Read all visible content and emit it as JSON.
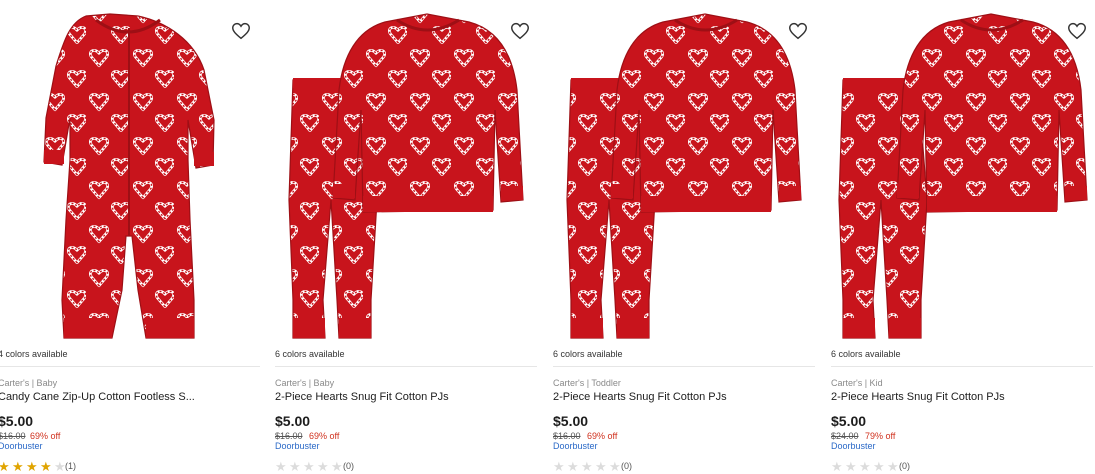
{
  "colors": {
    "garment": "#c8141c",
    "garment_dark": "#9e0f15",
    "print": "#ffffff",
    "price_off": "#d0311e",
    "badge": "#2a69c7",
    "star": "#e0a400"
  },
  "products": [
    {
      "colors_available": "4 colors available",
      "brand": "Carter's | Baby",
      "title": "Candy Cane Zip-Up Cotton Footless S...",
      "price": "$5.00",
      "was_price": "$16.00",
      "discount": "69% off",
      "badge": "Doorbuster",
      "rating": 4,
      "review_count": "(1)",
      "favorite_icon": "heart-outline-icon",
      "image": "romper"
    },
    {
      "colors_available": "6 colors available",
      "brand": "Carter's | Baby",
      "title": "2-Piece Hearts Snug Fit Cotton PJs",
      "price": "$5.00",
      "was_price": "$16.00",
      "discount": "69% off",
      "badge": "Doorbuster",
      "rating": 0,
      "review_count": "(0)",
      "favorite_icon": "heart-outline-icon",
      "image": "pjs"
    },
    {
      "colors_available": "6 colors available",
      "brand": "Carter's | Toddler",
      "title": "2-Piece Hearts Snug Fit Cotton PJs",
      "price": "$5.00",
      "was_price": "$16.00",
      "discount": "69% off",
      "badge": "Doorbuster",
      "rating": 0,
      "review_count": "(0)",
      "favorite_icon": "heart-outline-icon",
      "image": "pjs"
    },
    {
      "colors_available": "6 colors available",
      "brand": "Carter's | Kid",
      "title": "2-Piece Hearts Snug Fit Cotton PJs",
      "price": "$5.00",
      "was_price": "$24.00",
      "discount": "79% off",
      "badge": "Doorbuster",
      "rating": 0,
      "review_count": "(0)",
      "favorite_icon": "heart-outline-icon",
      "image": "pjs-kid"
    }
  ]
}
